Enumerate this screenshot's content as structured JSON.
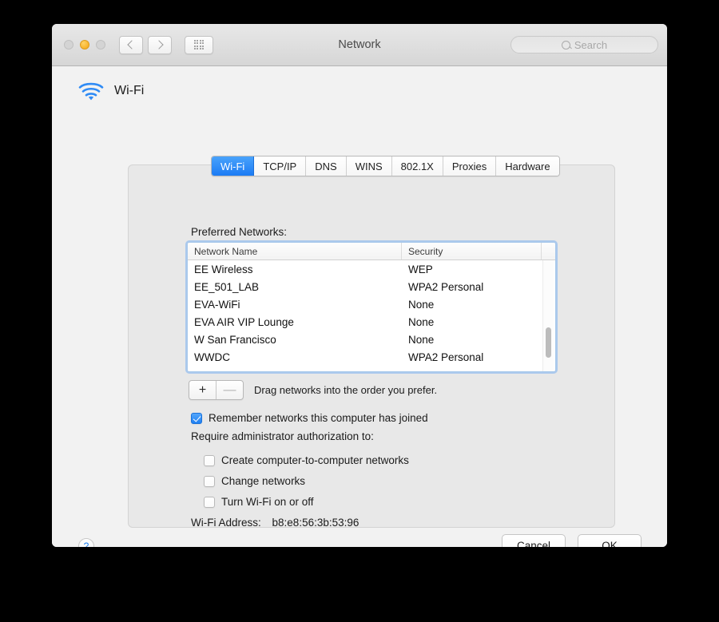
{
  "window": {
    "title": "Network",
    "traffic_lights": [
      "close",
      "minimize",
      "zoom"
    ],
    "nav_back": "back",
    "nav_forward": "forward",
    "grid_button": "show-all"
  },
  "search": {
    "placeholder": "Search",
    "value": "",
    "icon": "search-icon"
  },
  "service": {
    "icon": "wifi-icon",
    "name": "Wi-Fi"
  },
  "tabs": [
    {
      "label": "Wi-Fi",
      "active": true
    },
    {
      "label": "TCP/IP",
      "active": false
    },
    {
      "label": "DNS",
      "active": false
    },
    {
      "label": "WINS",
      "active": false
    },
    {
      "label": "802.1X",
      "active": false
    },
    {
      "label": "Proxies",
      "active": false
    },
    {
      "label": "Hardware",
      "active": false
    }
  ],
  "preferred_networks": {
    "label": "Preferred Networks:",
    "columns": [
      "Network Name",
      "Security"
    ],
    "rows": [
      {
        "name": "EE Wireless",
        "security": "WEP"
      },
      {
        "name": "EE_501_LAB",
        "security": "WPA2 Personal"
      },
      {
        "name": "EVA-WiFi",
        "security": "None"
      },
      {
        "name": "EVA AIR VIP Lounge",
        "security": "None"
      },
      {
        "name": "W San Francisco",
        "security": "None"
      },
      {
        "name": "WWDC",
        "security": "WPA2 Personal"
      }
    ]
  },
  "list_controls": {
    "add_label": "+",
    "remove_label": "—",
    "hint": "Drag networks into the order you prefer."
  },
  "remember_option": {
    "label": "Remember networks this computer has joined",
    "checked": true
  },
  "admin_section": {
    "label": "Require administrator authorization to:",
    "options": [
      {
        "label": "Create computer-to-computer networks",
        "checked": false
      },
      {
        "label": "Change networks",
        "checked": false
      },
      {
        "label": "Turn Wi-Fi on or off",
        "checked": false
      }
    ]
  },
  "wifi_address": {
    "label": "Wi-Fi Address:",
    "value": "b8:e8:56:3b:53:96"
  },
  "footer": {
    "help_label": "?",
    "cancel_label": "Cancel",
    "ok_label": "OK"
  },
  "colors": {
    "accent_blue": "#1f80f3",
    "tab_active_blue": "#1b7bf4",
    "focus_ring": "#78aff0",
    "window_chrome": "#ececec",
    "panel_gray": "#e8e8e8",
    "minimize_yellow": "#f7b32b"
  }
}
